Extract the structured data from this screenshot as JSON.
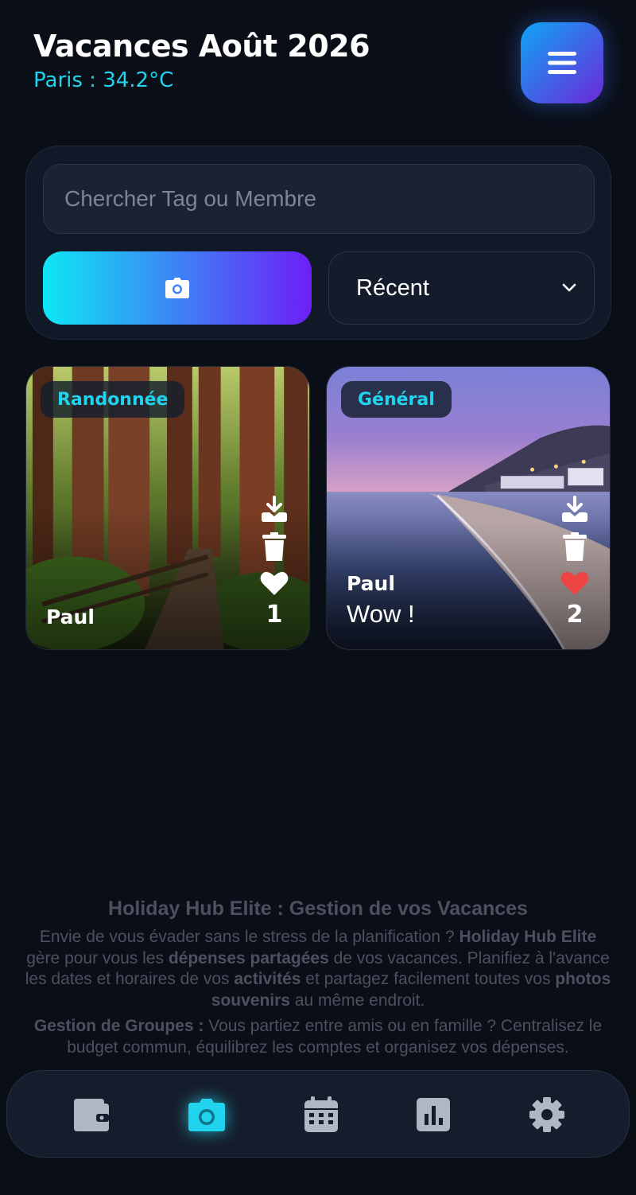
{
  "header": {
    "title": "Vacances Août 2026",
    "weather": "Paris : 34.2°C"
  },
  "search": {
    "placeholder": "Chercher Tag ou Membre",
    "sort_selected": "Récent"
  },
  "photos": [
    {
      "tag": "Randonnée",
      "author": "Paul",
      "caption": "",
      "likes": "1",
      "liked": false
    },
    {
      "tag": "Général",
      "author": "Paul",
      "caption": "Wow !",
      "likes": "2",
      "liked": true
    }
  ],
  "about": {
    "title": "Holiday Hub Elite : Gestion de vos Vacances",
    "p1": [
      "Envie de vous évader sans le stress de la planification ? ",
      "Holiday Hub Elite",
      " gère pour vous les ",
      "dépenses partagées",
      " de vos vacances. Planifiez à l'avance les dates et horaires de vos ",
      "activités",
      " et partagez facilement toutes vos ",
      "photos souvenirs",
      " au même endroit."
    ],
    "p2": [
      "Gestion de Groupes :",
      " Vous partiez entre amis ou en famille ? Centralisez le budget commun, équilibrez les comptes et organisez vos dépenses."
    ]
  },
  "nav": {
    "items": [
      "wallet-icon",
      "camera-icon",
      "calendar-icon",
      "chart-icon",
      "gear-icon"
    ],
    "active": "camera-icon"
  },
  "colors": {
    "accent": "#22d3ee",
    "background": "#0a0e17",
    "like": "#ef4444",
    "nav_icon": "#b0b6c2"
  }
}
